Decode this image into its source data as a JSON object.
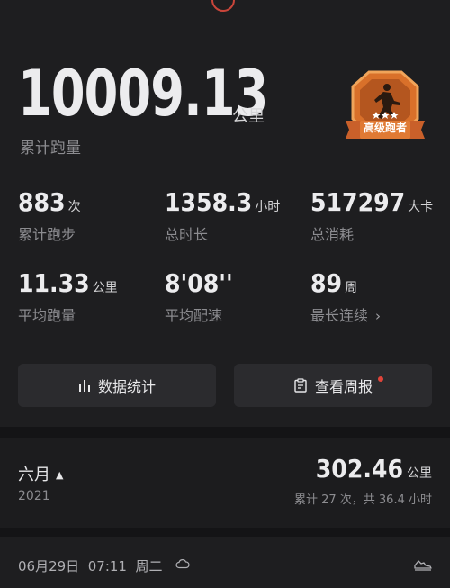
{
  "overview": {
    "total_distance": "10009.13",
    "total_distance_unit": "公里",
    "total_distance_label": "累计跑量",
    "badge_label": "高级跑者"
  },
  "stats": [
    {
      "value": "883",
      "unit": "次",
      "label": "累计跑步"
    },
    {
      "value": "1358.3",
      "unit": "小时",
      "label": "总时长"
    },
    {
      "value": "517297",
      "unit": "大卡",
      "label": "总消耗"
    },
    {
      "value": "11.33",
      "unit": "公里",
      "label": "平均跑量"
    },
    {
      "value": "8'08''",
      "unit": "",
      "label": "平均配速"
    },
    {
      "value": "89",
      "unit": "周",
      "label": "最长连续"
    }
  ],
  "buttons": {
    "data_stats": "数据统计",
    "weekly_report": "查看周报"
  },
  "month": {
    "name": "六月",
    "year": "2021",
    "distance": "302.46",
    "distance_unit": "公里",
    "summary": "累计 27 次，共 36.4 小时"
  },
  "run": {
    "date": "06月29日",
    "time": "07:11",
    "weekday": "周二"
  },
  "icons": [
    "bar-chart-icon",
    "report-icon",
    "cloud-icon",
    "shoe-icon",
    "badge-icon",
    "chevron-right-icon",
    "caret-up-icon"
  ],
  "colors": {
    "accent_red": "#e0443a",
    "badge_orange": "#d9702a"
  }
}
